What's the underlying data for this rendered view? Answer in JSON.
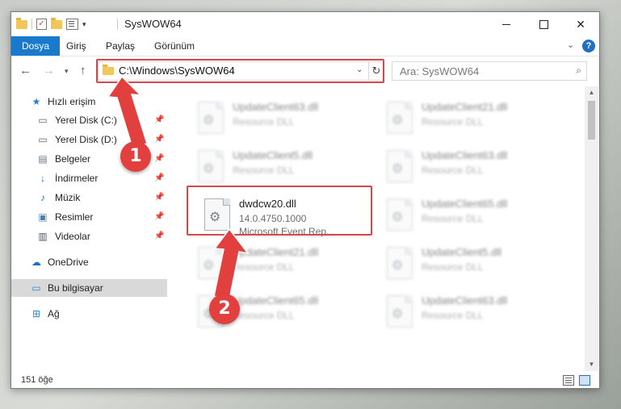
{
  "window": {
    "title": "SysWOW64",
    "controls": {
      "minimize": "–",
      "maximize": "□",
      "close": "✕"
    }
  },
  "qat": {
    "check_glyph": "✓",
    "dropdown_glyph": "▾"
  },
  "ribbon": {
    "tabs": [
      "Dosya",
      "Giriş",
      "Paylaş",
      "Görünüm"
    ],
    "expand_glyph": "⌄",
    "help_glyph": "?"
  },
  "navigation": {
    "back_glyph": "←",
    "forward_glyph": "→",
    "recent_glyph": "▾",
    "up_glyph": "↑",
    "address": "C:\\Windows\\SysWOW64",
    "address_dropdown_glyph": "⌄",
    "refresh_glyph": "↻",
    "search_placeholder": "Ara: SysWOW64",
    "search_glyph": "⌕"
  },
  "sidebar": {
    "pin_glyph": "📌",
    "items": [
      {
        "label": "Hızlı erişim",
        "icon": "star-icon",
        "glyph": "★",
        "color": "#2b7bd6",
        "pinned": false
      },
      {
        "label": "Yerel Disk (C:)",
        "icon": "drive-c-icon",
        "glyph": "▭",
        "color": "#5a6470",
        "pinned": true
      },
      {
        "label": "Yerel Disk (D:)",
        "icon": "drive-d-icon",
        "glyph": "▭",
        "color": "#5a6470",
        "pinned": true
      },
      {
        "label": "Belgeler",
        "icon": "documents-icon",
        "glyph": "▤",
        "color": "#6a7684",
        "pinned": true
      },
      {
        "label": "İndirmeler",
        "icon": "downloads-icon",
        "glyph": "↓",
        "color": "#1f6fc4",
        "pinned": true
      },
      {
        "label": "Müzik",
        "icon": "music-icon",
        "glyph": "♪",
        "color": "#1f6fc4",
        "pinned": true
      },
      {
        "label": "Resimler",
        "icon": "pictures-icon",
        "glyph": "▣",
        "color": "#4d7fae",
        "pinned": true
      },
      {
        "label": "Videolar",
        "icon": "videos-icon",
        "glyph": "▥",
        "color": "#4d5560",
        "pinned": true
      },
      {
        "label": "OneDrive",
        "icon": "onedrive-icon",
        "glyph": "☁",
        "color": "#1f6fc4",
        "pinned": false
      },
      {
        "label": "Bu bilgisayar",
        "icon": "this-pc-icon",
        "glyph": "▭",
        "color": "#2a8ad4",
        "pinned": false
      },
      {
        "label": "Ağ",
        "icon": "network-icon",
        "glyph": "⊞",
        "color": "#2a8ad4",
        "pinned": false
      }
    ]
  },
  "files": [
    {
      "name": "UpdateClient63.dll",
      "type": "Resource DLL"
    },
    {
      "name": "UpdateClient21.dll",
      "type": "Resource DLL"
    },
    {
      "name": "UpdateClient5.dll",
      "type": "Resource DLL"
    },
    {
      "name": "UpdateClient63.dll",
      "type": "Resource DLL"
    },
    {
      "name": "dwdcw20.dll",
      "version": "14.0.4750.1000",
      "type": "Microsoft Event Rep..."
    },
    {
      "name": "UpdateClient65.dll",
      "type": "Resource DLL"
    },
    {
      "name": "UpdateClient21.dll",
      "type": "Resource DLL"
    },
    {
      "name": "UpdateClient5.dll",
      "type": "Resource DLL"
    },
    {
      "name": "UpdateClient65.dll",
      "type": "Resource DLL"
    },
    {
      "name": "UpdateClient63.dll",
      "type": "Resource DLL"
    }
  ],
  "scrollbar": {
    "up_glyph": "▲",
    "down_glyph": "▼"
  },
  "status": {
    "item_count": "151 öğe"
  },
  "annotations": {
    "step1": "1",
    "step2": "2",
    "highlight_color": "#d2494b",
    "badge_color": "#e2403e"
  }
}
